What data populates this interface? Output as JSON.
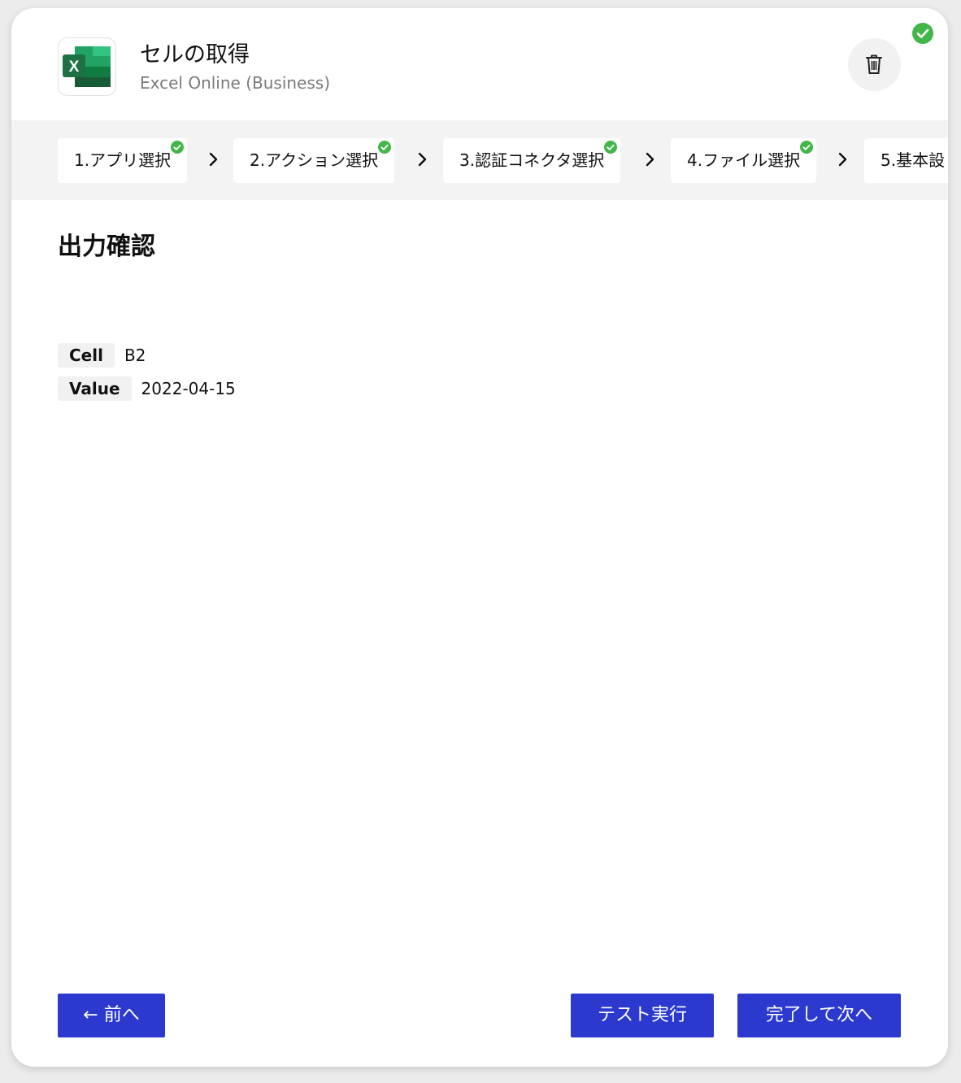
{
  "header": {
    "title": "セルの取得",
    "subtitle": "Excel Online (Business)",
    "app_icon": "excel-icon",
    "delete_icon": "trash-icon",
    "status_icon": "check-circle-icon"
  },
  "steps": [
    {
      "label": "1.アプリ選択",
      "completed": true
    },
    {
      "label": "2.アクション選択",
      "completed": true
    },
    {
      "label": "3.認証コネクタ選択",
      "completed": true
    },
    {
      "label": "4.ファイル選択",
      "completed": true
    },
    {
      "label": "5.基本設",
      "completed": false
    }
  ],
  "output": {
    "title": "出力確認",
    "rows": [
      {
        "key": "Cell",
        "value": "B2"
      },
      {
        "key": "Value",
        "value": "2022-04-15"
      }
    ]
  },
  "footer": {
    "prev_label": "← 前へ",
    "test_label": "テスト実行",
    "next_label": "完了して次へ"
  },
  "colors": {
    "primary": "#2b39cf",
    "success": "#43b649",
    "excel_green": "#1e7145"
  }
}
